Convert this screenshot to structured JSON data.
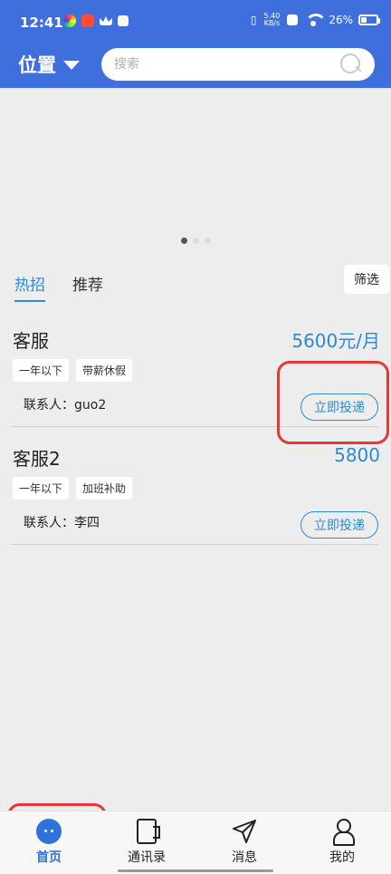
{
  "status": {
    "time": "12:41",
    "speed_top": "5.40",
    "speed_bottom": "KB/s",
    "battery": "26%"
  },
  "header": {
    "location_label": "位置",
    "search_placeholder": "搜索"
  },
  "tabs": [
    {
      "label": "热招",
      "active": true
    },
    {
      "label": "推荐",
      "active": false
    }
  ],
  "filter_label": "筛选",
  "jobs": [
    {
      "title": "客服",
      "salary": "5600元/月",
      "tags": [
        "一年以下",
        "带薪休假"
      ],
      "contact": "联系人：guo2",
      "apply_label": "立即投递"
    },
    {
      "title": "客服2",
      "salary": "5800",
      "tags": [
        "一年以下",
        "加班补助"
      ],
      "contact": "联系人：李四",
      "apply_label": "立即投递"
    }
  ],
  "bottom_nav": [
    {
      "label": "首页",
      "icon": "home-chat-icon"
    },
    {
      "label": "通讯录",
      "icon": "address-book-icon"
    },
    {
      "label": "消息",
      "icon": "send-icon"
    },
    {
      "label": "我的",
      "icon": "user-icon"
    }
  ],
  "colors": {
    "primary": "#3f6fdd",
    "accent": "#2f8ad0",
    "highlight": "#e53935"
  }
}
